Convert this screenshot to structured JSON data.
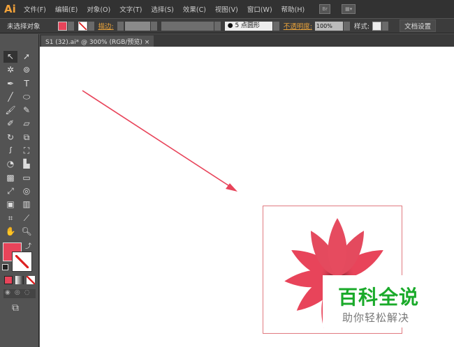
{
  "app": {
    "logo": "Ai"
  },
  "menu": [
    "文件(F)",
    "编辑(E)",
    "对象(O)",
    "文字(T)",
    "选择(S)",
    "效果(C)",
    "视图(V)",
    "窗口(W)",
    "帮助(H)"
  ],
  "menu_icons": {
    "bridge": "Br"
  },
  "control": {
    "selection": "未选择对象",
    "stroke_label": "描边:",
    "brush": "5 点圆形",
    "opacity_label": "不透明度:",
    "opacity": "100%",
    "style_label": "样式:",
    "doc_setup": "文档设置"
  },
  "colors": {
    "fill": "#e8445a",
    "accent": "#f2a23a"
  },
  "tab": {
    "title": "S1 (32).ai* @ 300% (RGB/预览)",
    "close": "×"
  },
  "watermark": {
    "title": "百科全说",
    "subtitle": "助你轻松解决"
  }
}
